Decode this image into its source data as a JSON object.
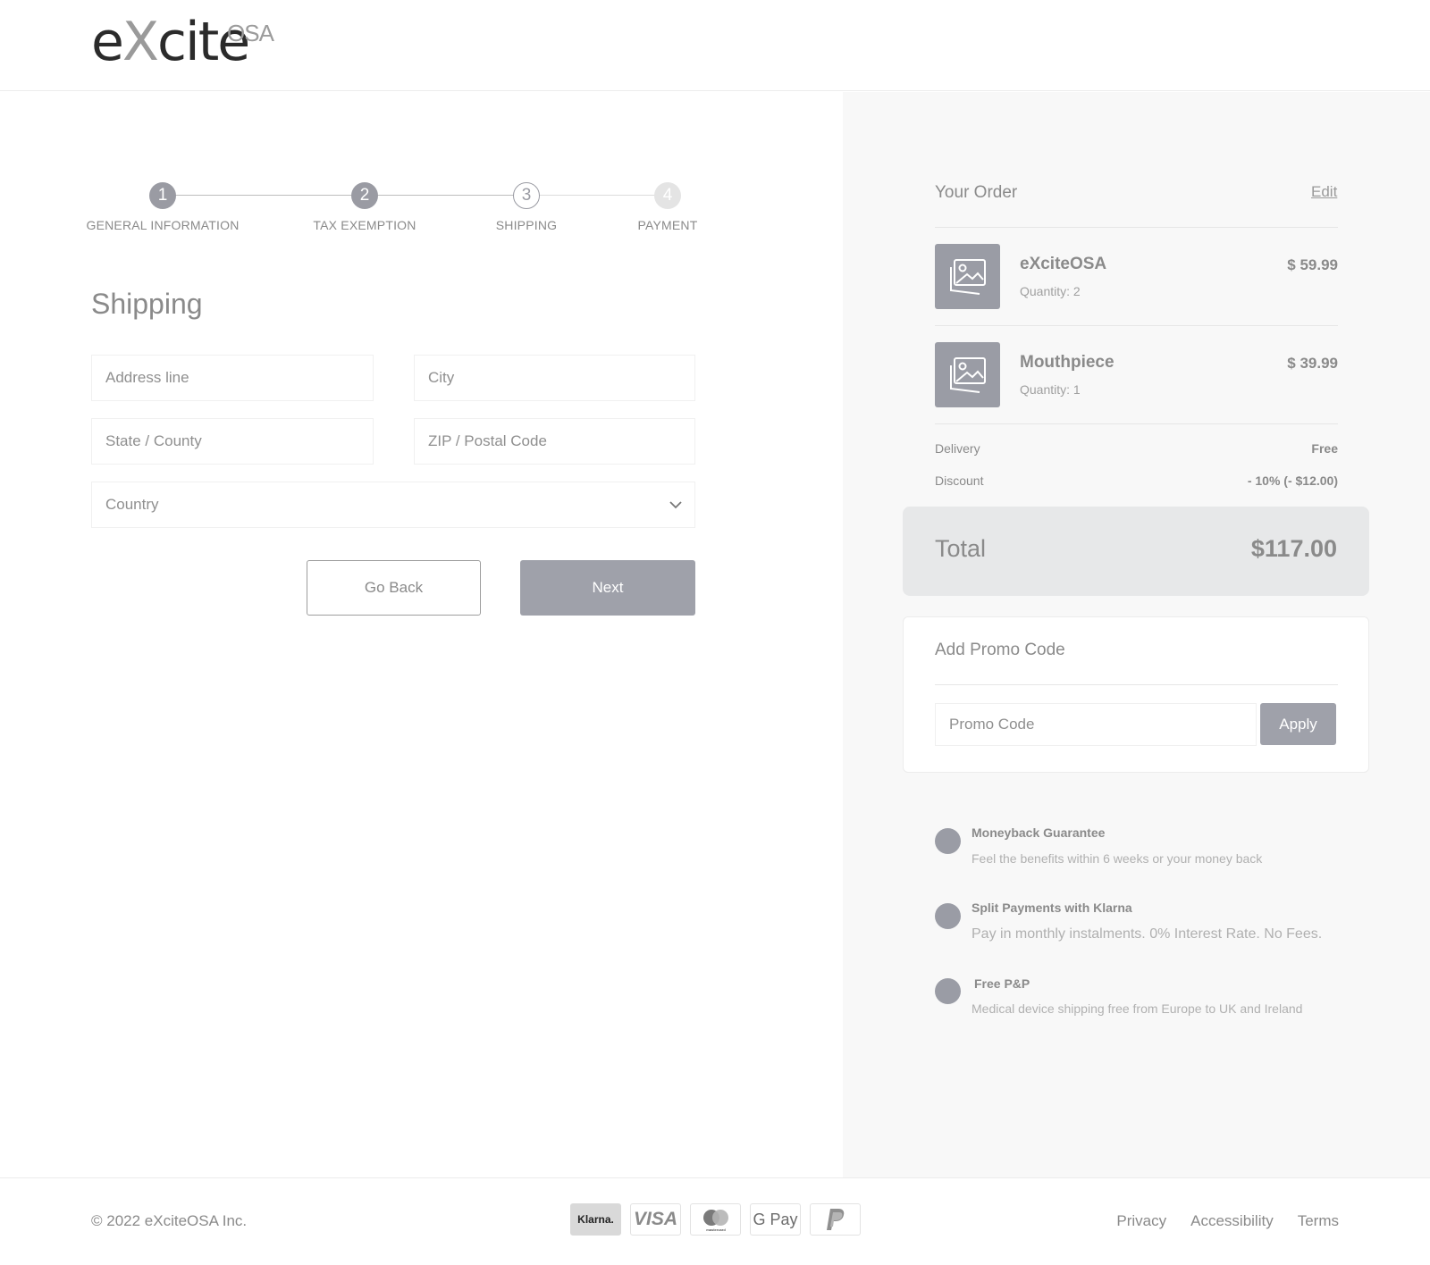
{
  "brand": {
    "logo_main_before": "e",
    "logo_main_x": "X",
    "logo_main_after": "cite",
    "logo_sup": "OSA"
  },
  "stepper": {
    "steps": [
      {
        "number": "1",
        "label": "GENERAL INFORMATION",
        "state": "done"
      },
      {
        "number": "2",
        "label": "TAX EXEMPTION",
        "state": "done"
      },
      {
        "number": "3",
        "label": "SHIPPING",
        "state": "current"
      },
      {
        "number": "4",
        "label": "PAYMENT",
        "state": "future"
      }
    ]
  },
  "form": {
    "title": "Shipping",
    "address_placeholder": "Address line",
    "city_placeholder": "City",
    "state_placeholder": "State / County",
    "zip_placeholder": "ZIP / Postal Code",
    "country_placeholder": "Country",
    "back_label": "Go Back",
    "next_label": "Next"
  },
  "order": {
    "title": "Your Order",
    "edit_label": "Edit",
    "items": [
      {
        "name": "eXciteOSA",
        "qty_label": "Quantity:",
        "qty": "2",
        "price": "$ 59.99"
      },
      {
        "name": "Mouthpiece",
        "qty_label": "Quantity:",
        "qty": "1",
        "price": "$ 39.99"
      }
    ],
    "delivery_label": "Delivery",
    "delivery_value": "Free",
    "discount_label": "Discount",
    "discount_value": "- 10% (- $12.00)",
    "total_label": "Total",
    "total_value": "$117.00"
  },
  "promo": {
    "title": "Add Promo Code",
    "placeholder": "Promo Code",
    "apply_label": "Apply"
  },
  "benefits": [
    {
      "title": "Moneyback Guarantee",
      "text": "Feel the benefits within 6 weeks or your money back"
    },
    {
      "title": "Split Payments with Klarna",
      "text": "Pay in monthly instalments.  0% Interest Rate. No Fees."
    },
    {
      "title": "Free P&P",
      "text": "Medical device shipping free from Europe to UK and Ireland"
    }
  ],
  "footer": {
    "copyright": "© 2022 eXciteOSA Inc.",
    "payment_methods": [
      "Klarna.",
      "VISA",
      "mastercard",
      "G Pay",
      "paypal-icon"
    ],
    "links": [
      "Privacy",
      "Accessibility",
      "Terms"
    ]
  },
  "colors": {
    "accent_gray": "#9fa1aa",
    "panel_bg": "#f8f8f8",
    "total_bg": "#e7e8e9"
  }
}
